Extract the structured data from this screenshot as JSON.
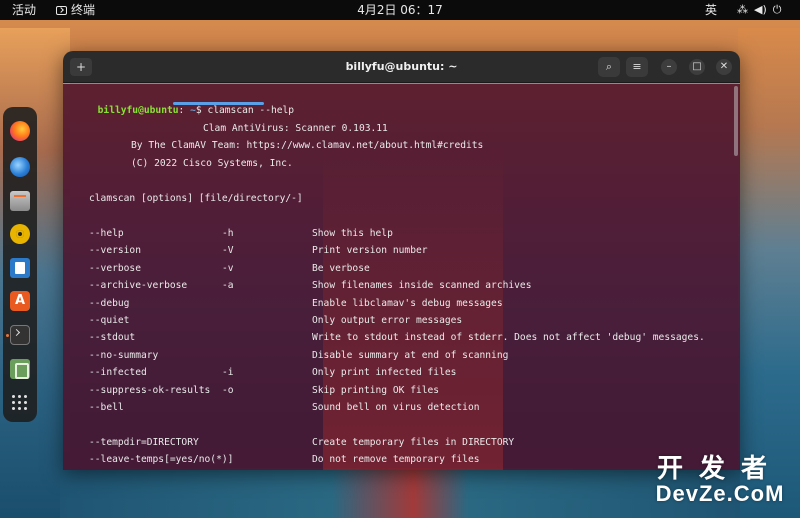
{
  "topbar": {
    "activities": "活动",
    "app_name": "终端",
    "clock": "4月2日 06：17",
    "input_method": "英",
    "tray_icons": [
      "network-icon",
      "volume-icon",
      "power-icon"
    ]
  },
  "dock": {
    "items": [
      {
        "name": "firefox",
        "icon": "firefox-icon"
      },
      {
        "name": "thunderbird",
        "icon": "thunderbird-icon"
      },
      {
        "name": "files",
        "icon": "files-icon"
      },
      {
        "name": "rhythmbox",
        "icon": "rhythmbox-icon"
      },
      {
        "name": "libreoffice-writer",
        "icon": "writer-icon"
      },
      {
        "name": "app-center",
        "icon": "app-store-icon",
        "glyph": "A"
      },
      {
        "name": "terminal",
        "icon": "terminal-icon",
        "active": true
      },
      {
        "name": "trash",
        "icon": "trash-icon"
      },
      {
        "name": "show-apps",
        "icon": "app-grid-icon"
      }
    ]
  },
  "window": {
    "title": "billyfu@ubuntu: ~",
    "new_tab_glyph": "+",
    "search_glyph": "⌕",
    "menu_glyph": "≡",
    "minimize_glyph": "–",
    "maximize_glyph": "□",
    "close_glyph": "✕"
  },
  "terminal": {
    "prompt_user": "billyfu@ubuntu",
    "prompt_sep": ":",
    "prompt_path": "~",
    "prompt_symbol": "$",
    "command": "clamscan --help",
    "header": [
      "Clam AntiVirus: Scanner 0.103.11",
      "By The ClamAV Team: https://www.clamav.net/about.html#credits",
      "(C) 2022 Cisco Systems, Inc."
    ],
    "usage": "clamscan [options] [file/directory/-]",
    "options": [
      {
        "long": "--help",
        "short": "-h",
        "desc": "Show this help"
      },
      {
        "long": "--version",
        "short": "-V",
        "desc": "Print version number"
      },
      {
        "long": "--verbose",
        "short": "-v",
        "desc": "Be verbose"
      },
      {
        "long": "--archive-verbose",
        "short": "-a",
        "desc": "Show filenames inside scanned archives"
      },
      {
        "long": "--debug",
        "short": "",
        "desc": "Enable libclamav's debug messages"
      },
      {
        "long": "--quiet",
        "short": "",
        "desc": "Only output error messages"
      },
      {
        "long": "--stdout",
        "short": "",
        "desc": "Write to stdout instead of stderr. Does not affect 'debug' messages."
      },
      {
        "long": "--no-summary",
        "short": "",
        "desc": "Disable summary at end of scanning"
      },
      {
        "long": "--infected",
        "short": "-i",
        "desc": "Only print infected files"
      },
      {
        "long": "--suppress-ok-results",
        "short": "-o",
        "desc": "Skip printing OK files"
      },
      {
        "long": "--bell",
        "short": "",
        "desc": "Sound bell on virus detection"
      }
    ],
    "options2": [
      {
        "long": "--tempdir=DIRECTORY",
        "short": "",
        "desc": "Create temporary files in DIRECTORY"
      },
      {
        "long": "--leave-temps[=yes/no(*)]",
        "short": "",
        "desc": "Do not remove temporary files"
      }
    ]
  },
  "watermark": {
    "cn": "开发者",
    "en": "DevZe.CoM"
  }
}
